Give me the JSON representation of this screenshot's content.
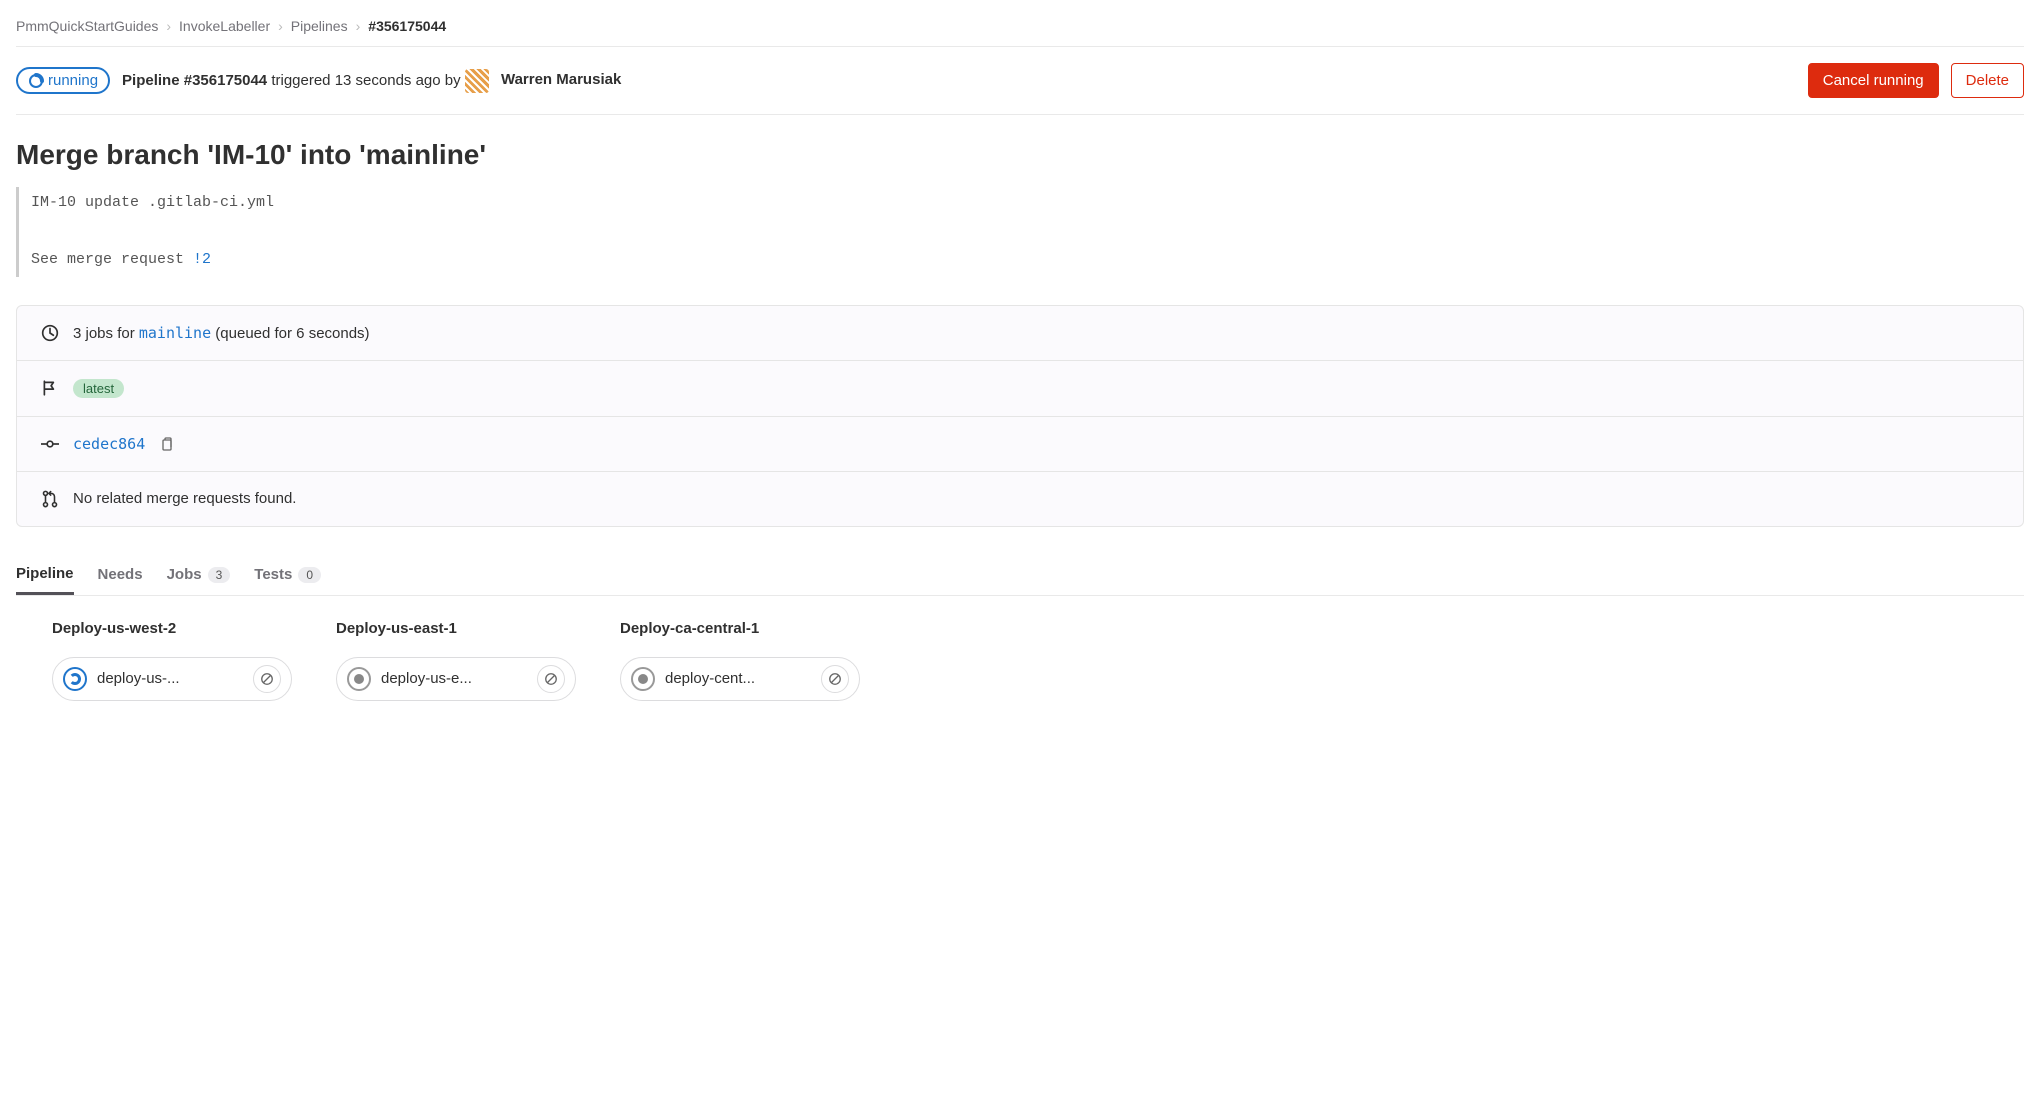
{
  "breadcrumbs": {
    "items": [
      "PmmQuickStartGuides",
      "InvokeLabeller",
      "Pipelines"
    ],
    "current": "#356175044"
  },
  "header": {
    "status": "running",
    "pipeline_prefix": "Pipeline #356175044",
    "triggered_text": " triggered 13 seconds ago by ",
    "username": "Warren Marusiak",
    "cancel_label": "Cancel running",
    "delete_label": "Delete"
  },
  "title": "Merge branch 'IM-10' into 'mainline'",
  "commit_message": {
    "line1": "IM-10 update .gitlab-ci.yml",
    "line2_prefix": "See merge request ",
    "mr_ref": "!2"
  },
  "info": {
    "jobs_prefix": "3 jobs for ",
    "branch": "mainline",
    "jobs_suffix": " (queued for 6 seconds)",
    "latest_badge": "latest",
    "commit_sha": "cedec864",
    "mr_text": "No related merge requests found."
  },
  "tabs": [
    {
      "label": "Pipeline",
      "count": null,
      "active": true
    },
    {
      "label": "Needs",
      "count": null,
      "active": false
    },
    {
      "label": "Jobs",
      "count": "3",
      "active": false
    },
    {
      "label": "Tests",
      "count": "0",
      "active": false
    }
  ],
  "stages": [
    {
      "title": "Deploy-us-west-2",
      "job_name": "deploy-us-...",
      "status": "running"
    },
    {
      "title": "Deploy-us-east-1",
      "job_name": "deploy-us-e...",
      "status": "pending"
    },
    {
      "title": "Deploy-ca-central-1",
      "job_name": "deploy-cent...",
      "status": "pending"
    }
  ]
}
